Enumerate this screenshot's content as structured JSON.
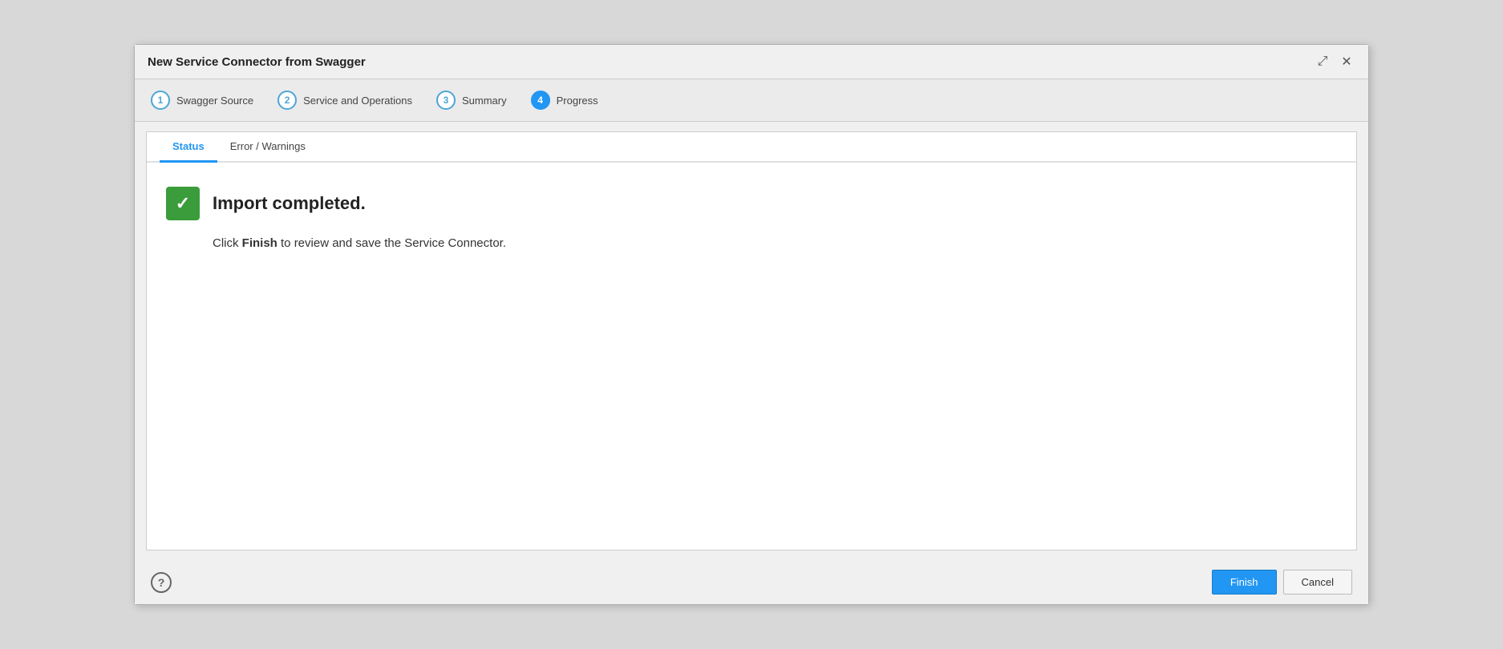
{
  "dialog": {
    "title": "New Service Connector from Swagger",
    "steps": [
      {
        "number": "1",
        "label": "Swagger Source",
        "active": false
      },
      {
        "number": "2",
        "label": "Service and Operations",
        "active": false
      },
      {
        "number": "3",
        "label": "Summary",
        "active": false
      },
      {
        "number": "4",
        "label": "Progress",
        "active": true
      }
    ],
    "tabs": [
      {
        "label": "Status",
        "active": true
      },
      {
        "label": "Error / Warnings",
        "active": false
      }
    ],
    "status": {
      "icon": "✓",
      "title": "Import completed.",
      "message_prefix": "Click ",
      "message_bold": "Finish",
      "message_suffix": " to review and save the Service Connector."
    },
    "footer": {
      "help_label": "?",
      "finish_label": "Finish",
      "cancel_label": "Cancel"
    }
  },
  "icons": {
    "maximize": "⤢",
    "close": "✕"
  }
}
